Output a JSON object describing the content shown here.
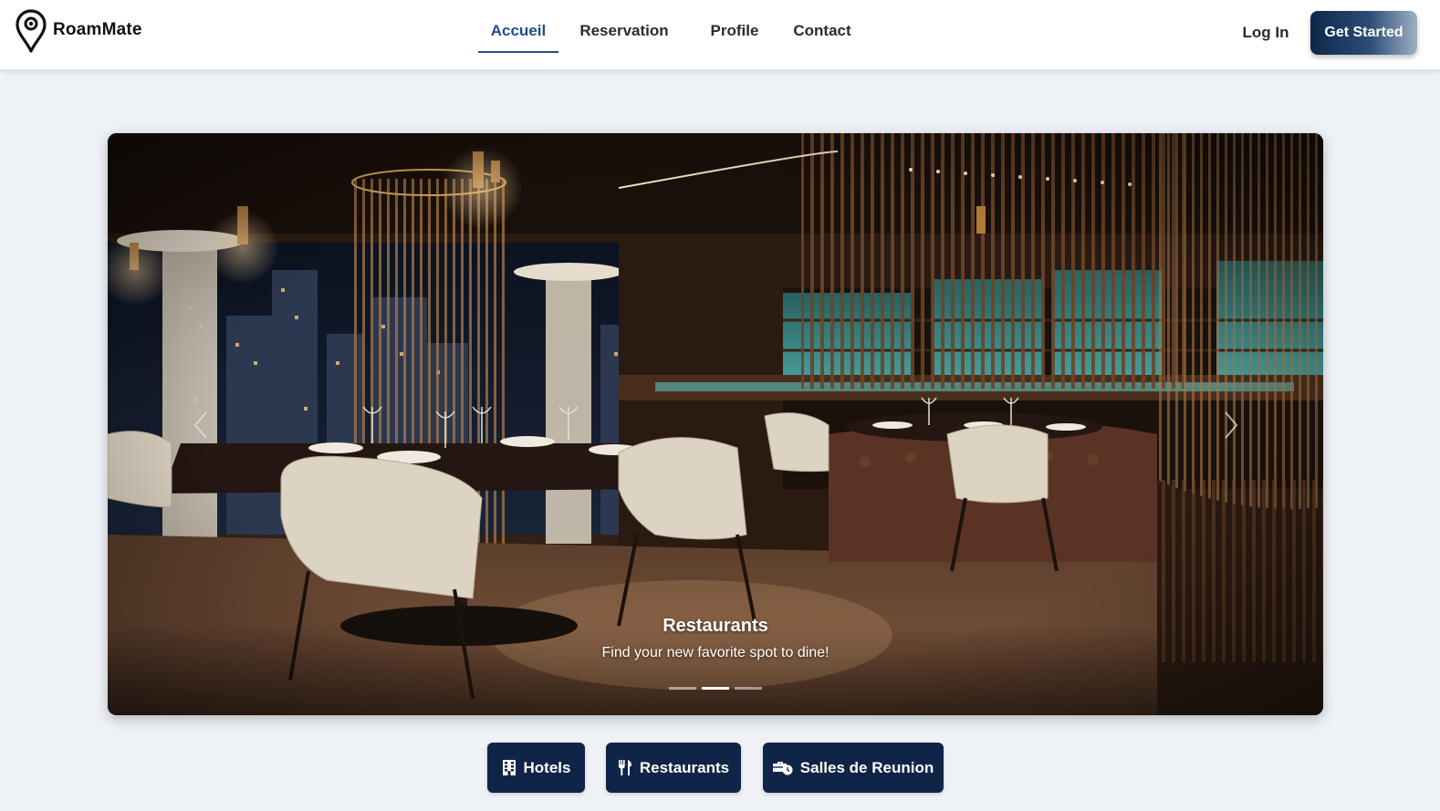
{
  "brand": {
    "name": "RoamMate",
    "icon": "map-pin-icon"
  },
  "nav": {
    "links": [
      "Accueil",
      "Reservation",
      "Profile",
      "Contact"
    ],
    "active": "Accueil"
  },
  "auth": {
    "login_label": "Log In",
    "cta_label": "Get Started"
  },
  "carousel": {
    "slide_title": "Restaurants",
    "slide_text": "Find your new favorite spot to dine!",
    "slide_count": 3,
    "active_slide": 2,
    "prev_icon": "chevron-left-icon",
    "next_icon": "chevron-right-icon"
  },
  "categories": [
    {
      "label": "Hotels",
      "icon": "building-icon"
    },
    {
      "label": "Restaurants",
      "icon": "utensils-icon"
    },
    {
      "label": "Salles de Reunion",
      "icon": "briefcase-clock-icon"
    }
  ],
  "colors": {
    "primary_dark": "#0f2547",
    "active_nav": "#1f4e8c",
    "page_background": "#eef2f7",
    "bar_accent_teal": "#3fb5b5"
  }
}
